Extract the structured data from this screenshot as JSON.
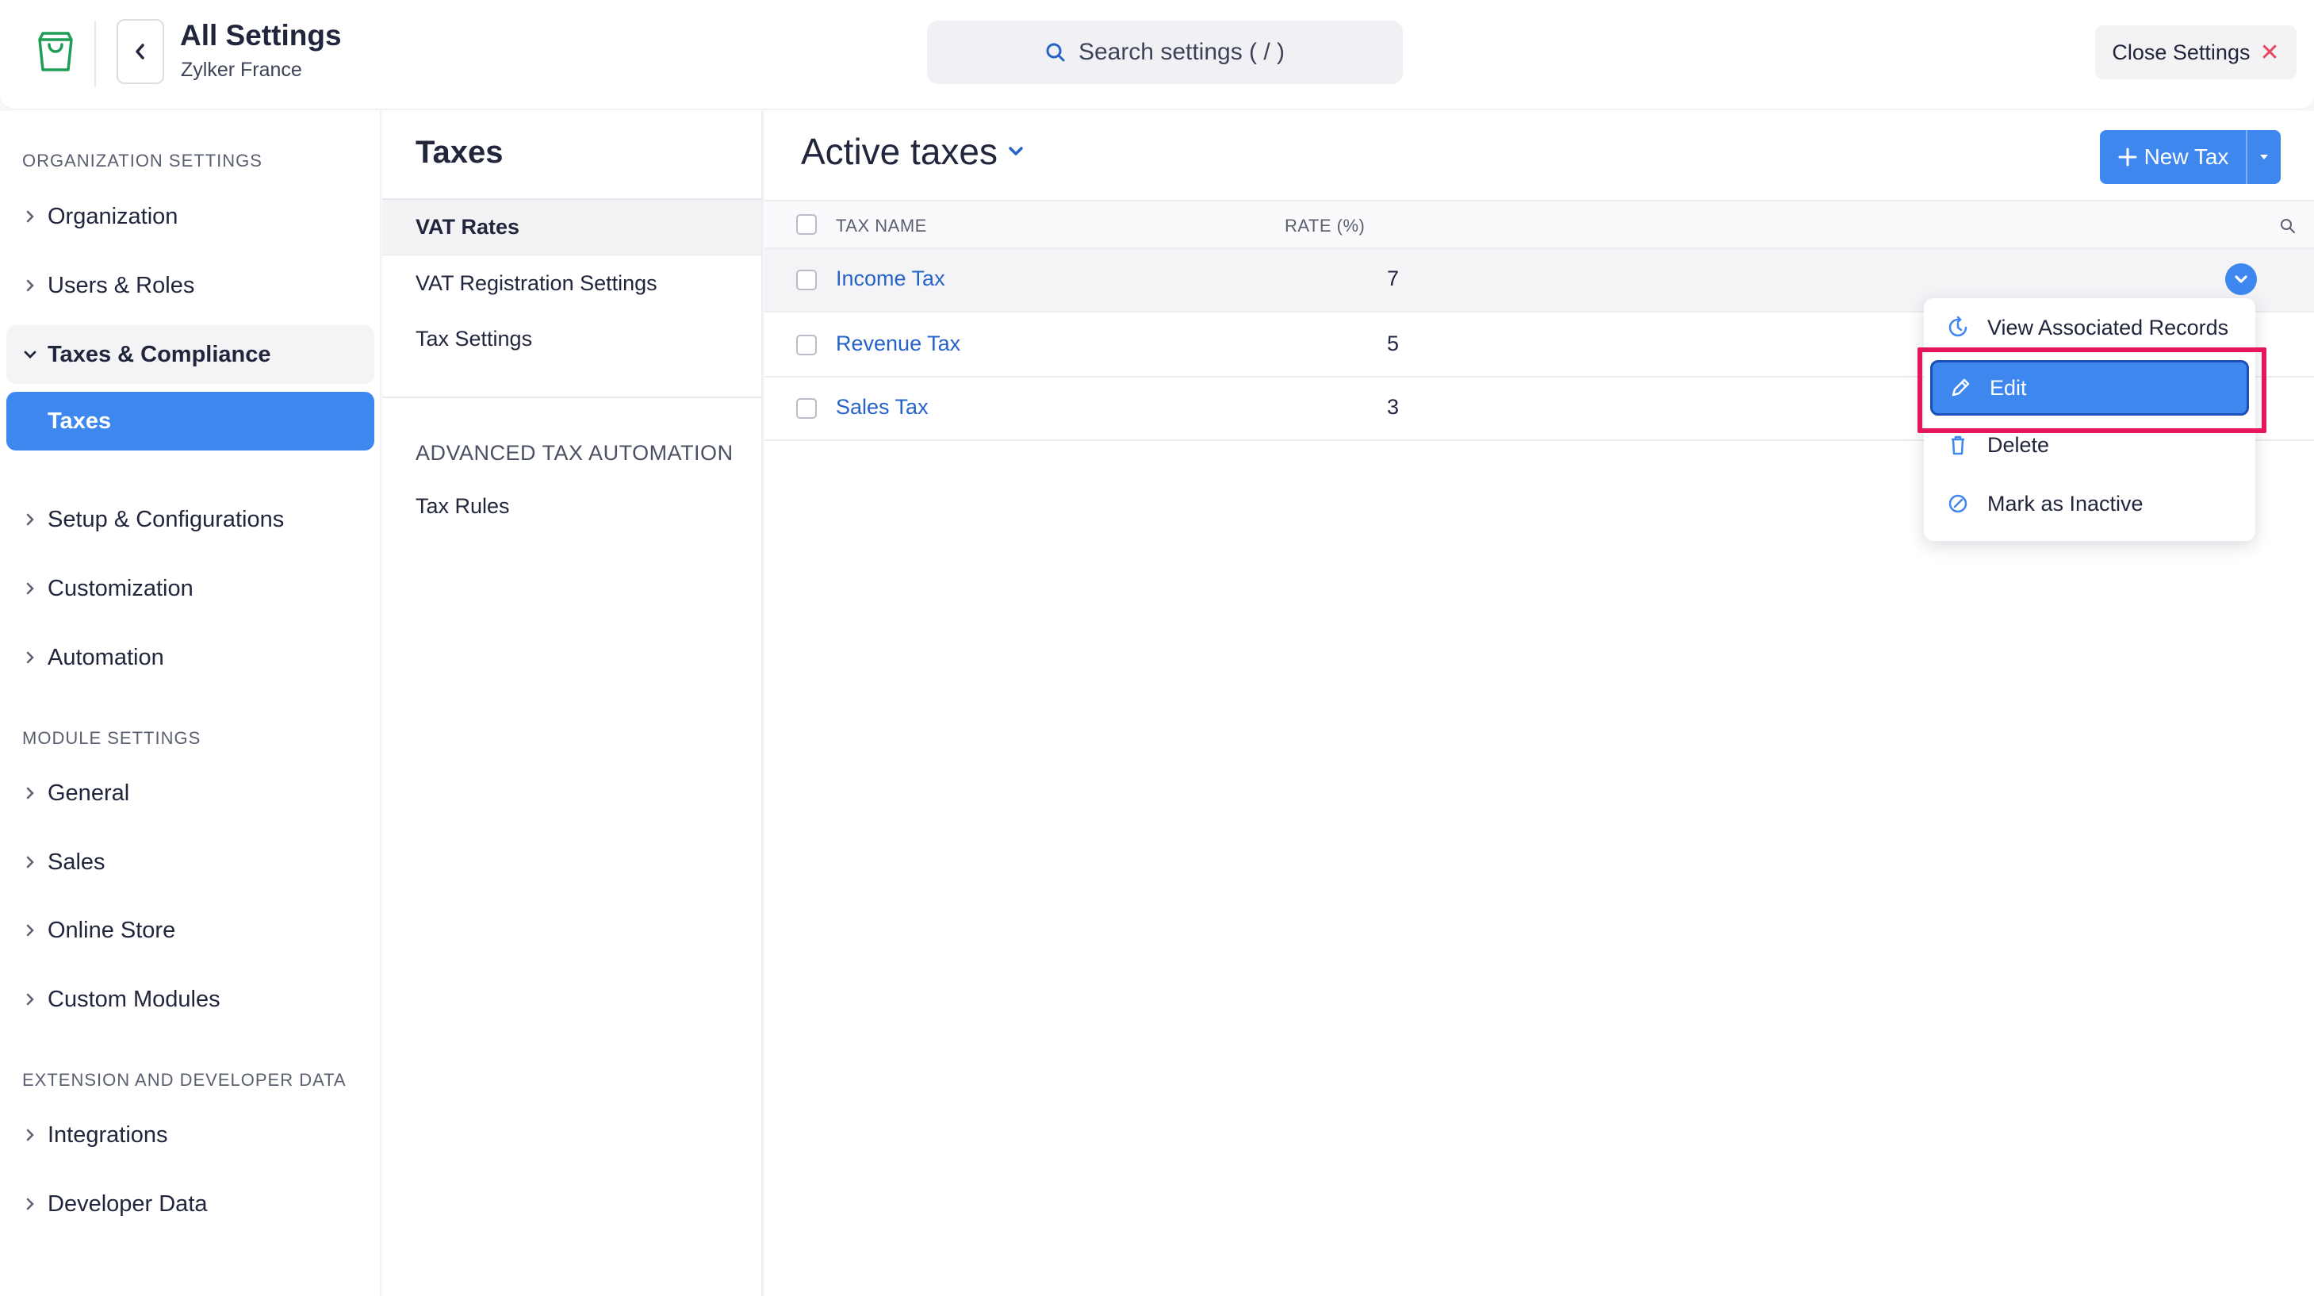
{
  "header": {
    "app_title": "All Settings",
    "org_name": "Zylker France",
    "search_placeholder": "Search settings ( / )",
    "close_label": "Close Settings",
    "brand_color": "#1f9d55"
  },
  "sidebar": {
    "sections": [
      {
        "title": "ORGANIZATION SETTINGS"
      },
      {
        "title": "MODULE SETTINGS"
      },
      {
        "title": "EXTENSION AND DEVELOPER DATA"
      }
    ],
    "items": [
      {
        "label": "Organization",
        "state": "collapsed"
      },
      {
        "label": "Users & Roles",
        "state": "collapsed"
      },
      {
        "label": "Taxes & Compliance",
        "state": "expanded"
      },
      {
        "label": "Taxes",
        "state": "active"
      },
      {
        "label": "Setup & Configurations",
        "state": "collapsed"
      },
      {
        "label": "Customization",
        "state": "collapsed"
      },
      {
        "label": "Automation",
        "state": "collapsed"
      },
      {
        "label": "General",
        "state": "collapsed"
      },
      {
        "label": "Sales",
        "state": "collapsed"
      },
      {
        "label": "Online Store",
        "state": "collapsed"
      },
      {
        "label": "Custom Modules",
        "state": "collapsed"
      },
      {
        "label": "Integrations",
        "state": "collapsed"
      },
      {
        "label": "Developer Data",
        "state": "collapsed"
      }
    ]
  },
  "midpanel": {
    "title": "Taxes",
    "items": [
      {
        "label": "VAT Rates",
        "selected": true
      },
      {
        "label": "VAT Registration Settings",
        "selected": false
      },
      {
        "label": "Tax Settings",
        "selected": false
      }
    ],
    "section_title": "ADVANCED TAX AUTOMATION",
    "section_items": [
      {
        "label": "Tax Rules"
      }
    ]
  },
  "main": {
    "title": "Active taxes",
    "new_button_label": "New Tax",
    "columns": [
      "TAX NAME",
      "RATE (%)"
    ],
    "rows": [
      {
        "name": "Income Tax",
        "rate": "7"
      },
      {
        "name": "Revenue Tax",
        "rate": "5"
      },
      {
        "name": "Sales Tax",
        "rate": "3"
      }
    ]
  },
  "row_menu": {
    "items": [
      {
        "label": "View Associated Records",
        "icon": "history-icon"
      },
      {
        "label": "Edit",
        "icon": "pencil-icon"
      },
      {
        "label": "Delete",
        "icon": "trash-icon"
      },
      {
        "label": "Mark as Inactive",
        "icon": "inactive-icon"
      }
    ],
    "highlighted_item": "Edit",
    "highlight_color": "#e5165a"
  },
  "colors": {
    "accent": "#3e87ef",
    "link": "#2563c9"
  }
}
